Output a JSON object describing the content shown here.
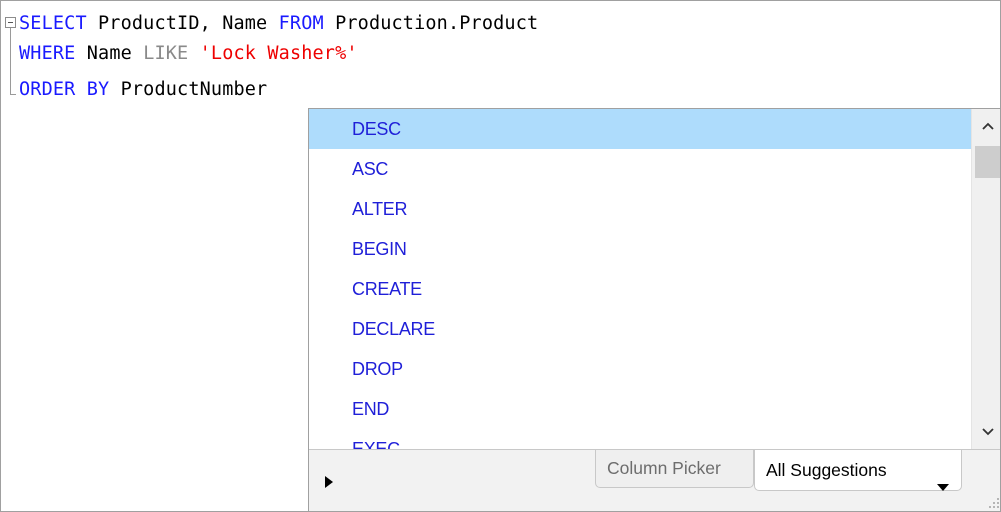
{
  "editor": {
    "lines": [
      {
        "tokens": [
          {
            "text": "SELECT",
            "kind": "kw"
          },
          {
            "text": " ProductID, Name ",
            "kind": "plain"
          },
          {
            "text": "FROM",
            "kind": "kw"
          },
          {
            "text": " Production.Product",
            "kind": "plain"
          }
        ]
      },
      {
        "tokens": [
          {
            "text": "WHERE",
            "kind": "kw"
          },
          {
            "text": " Name ",
            "kind": "plain"
          },
          {
            "text": "LIKE",
            "kind": "kw-gray"
          },
          {
            "text": " ",
            "kind": "plain"
          },
          {
            "text": "'Lock Washer%'",
            "kind": "str"
          }
        ]
      },
      {
        "tokens": [
          {
            "text": "ORDER BY",
            "kind": "kw"
          },
          {
            "text": " ProductNumber",
            "kind": "plain"
          }
        ]
      }
    ]
  },
  "completion": {
    "items": [
      {
        "label": "DESC",
        "selected": true
      },
      {
        "label": "ASC",
        "selected": false
      },
      {
        "label": "ALTER",
        "selected": false
      },
      {
        "label": "BEGIN",
        "selected": false
      },
      {
        "label": "CREATE",
        "selected": false
      },
      {
        "label": "DECLARE",
        "selected": false
      },
      {
        "label": "DROP",
        "selected": false
      },
      {
        "label": "END",
        "selected": false
      },
      {
        "label": "EXEC",
        "selected": false
      }
    ],
    "footer": {
      "expand_icon": "play-arrow-icon",
      "tab_column_picker": "Column Picker",
      "tab_all_suggestions": "All Suggestions",
      "dropdown_icon": "caret-down-icon"
    },
    "scrollbar": {
      "up_icon": "chevron-up-icon",
      "down_icon": "chevron-down-icon"
    }
  },
  "colors": {
    "keyword": "#1a1aff",
    "keyword_gray": "#8a8a8a",
    "string": "#ee0000",
    "selection": "#aedcfc",
    "completion_text": "#1f1fd8"
  }
}
